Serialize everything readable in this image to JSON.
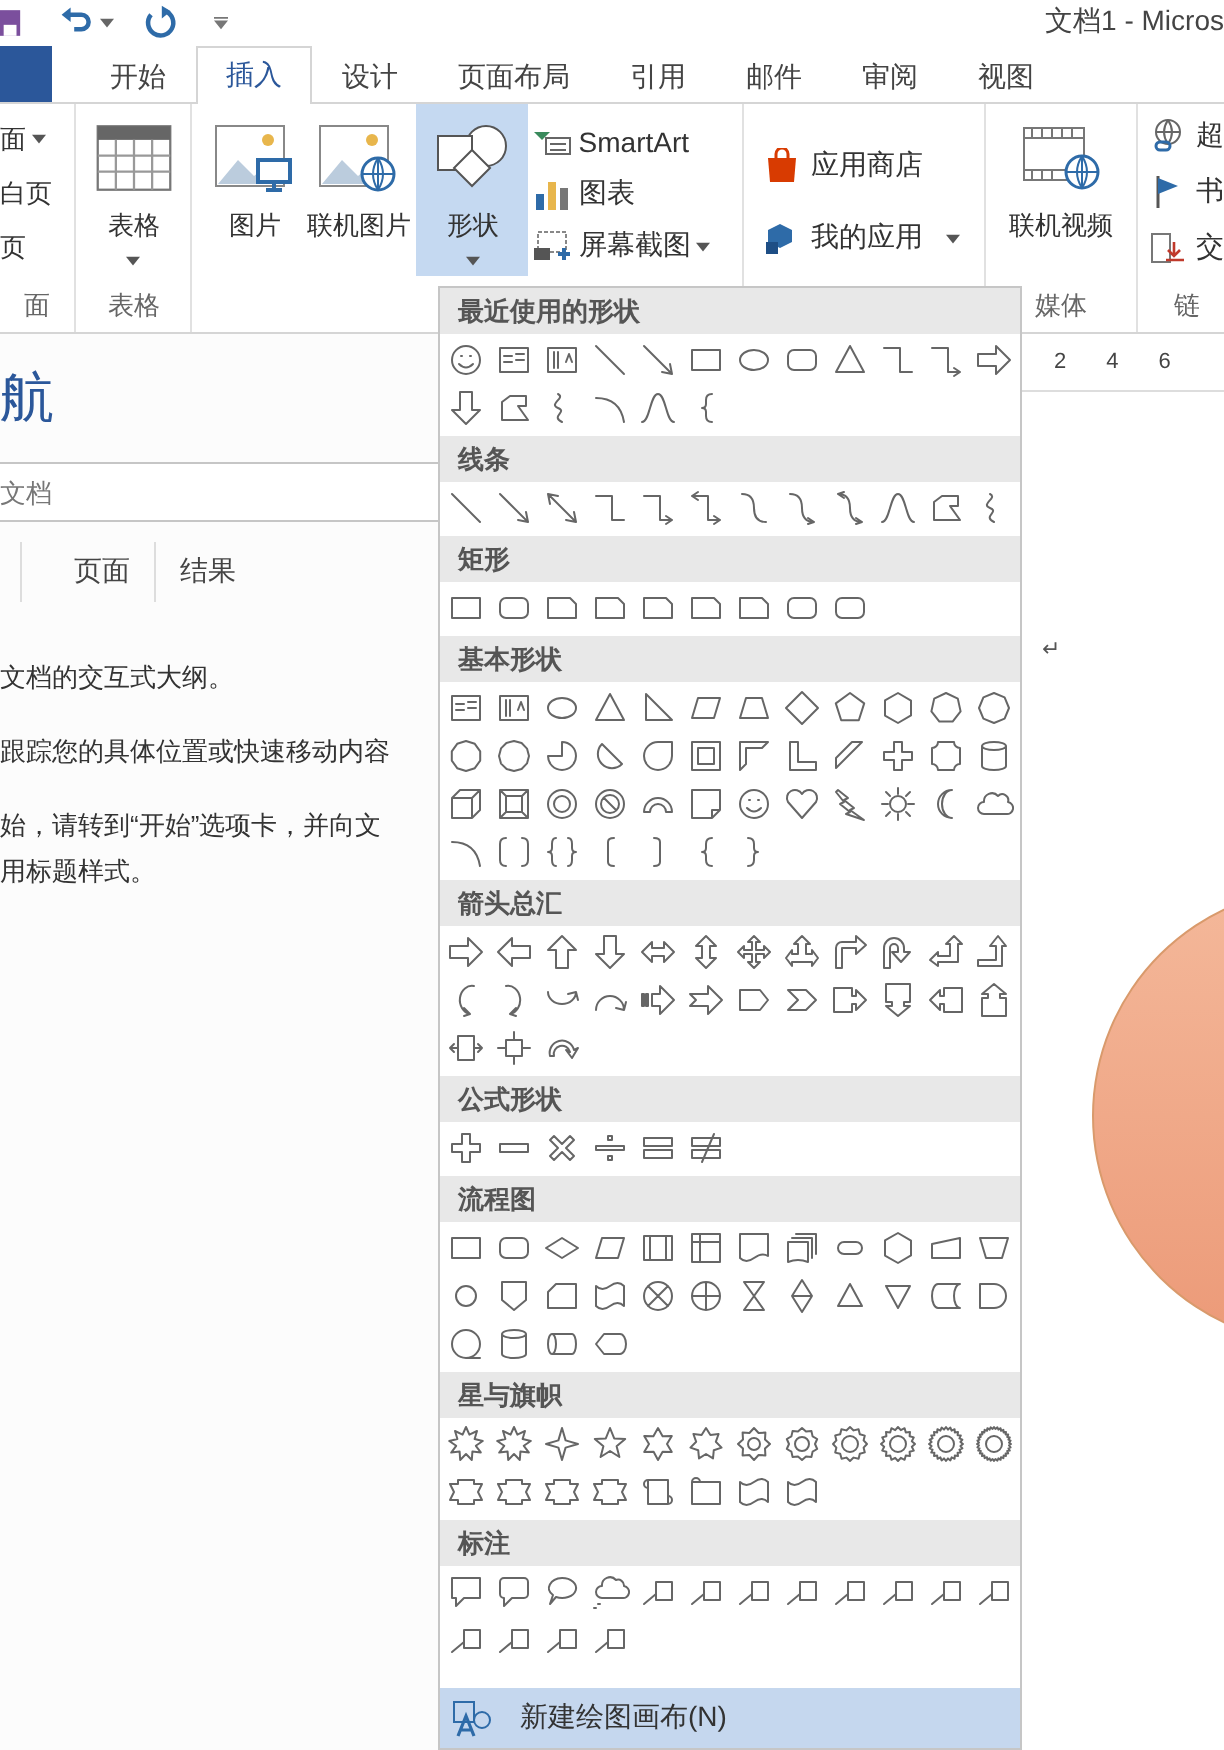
{
  "window": {
    "title": "文档1 - Micros"
  },
  "tabs": [
    {
      "label": "开始",
      "selected": false
    },
    {
      "label": "插入",
      "selected": true
    },
    {
      "label": "设计",
      "selected": false
    },
    {
      "label": "页面布局",
      "selected": false
    },
    {
      "label": "引用",
      "selected": false
    },
    {
      "label": "邮件",
      "selected": false
    },
    {
      "label": "审阅",
      "selected": false
    },
    {
      "label": "视图",
      "selected": false
    }
  ],
  "ribbon": {
    "pages": {
      "items": [
        "面",
        "白页",
        "页"
      ],
      "label": "面"
    },
    "tables": {
      "button": "表格",
      "label": "表格"
    },
    "illustrations": {
      "big_buttons": [
        {
          "label": "图片",
          "selected": false
        },
        {
          "label": "联机图片",
          "selected": false
        },
        {
          "label": "形状",
          "selected": true
        }
      ],
      "small_buttons": [
        "SmartArt",
        "图表",
        "屏幕截图"
      ]
    },
    "apps": {
      "buttons": [
        "应用商店",
        "我的应用"
      ]
    },
    "media": {
      "button": "联机视频",
      "label": "媒体"
    },
    "links": {
      "buttons": [
        "超",
        "书",
        "交"
      ],
      "label": "链"
    }
  },
  "nav_pane": {
    "title": "航",
    "search": {
      "placeholder": "文档"
    },
    "tabs": [
      {
        "label": "页面",
        "selected": false
      },
      {
        "label": "结果",
        "selected": false
      }
    ],
    "paragraphs": [
      [
        "文档的交互式大纲。"
      ],
      [
        "跟踪您的具体位置或快速移动内容"
      ],
      [
        "始，请转到“开始”选项卡，并向文",
        "用标题样式。"
      ]
    ]
  },
  "document": {
    "ruler": [
      "2",
      "4",
      "6"
    ],
    "paragraph_mark": "↵"
  },
  "shapes_menu": {
    "sections": [
      {
        "title": "最近使用的形状"
      },
      {
        "title": "线条"
      },
      {
        "title": "矩形"
      },
      {
        "title": "基本形状"
      },
      {
        "title": "箭头总汇"
      },
      {
        "title": "公式形状"
      },
      {
        "title": "流程图"
      },
      {
        "title": "星与旗帜"
      },
      {
        "title": "标注"
      }
    ],
    "footer": "新建绘图画布(N)"
  }
}
